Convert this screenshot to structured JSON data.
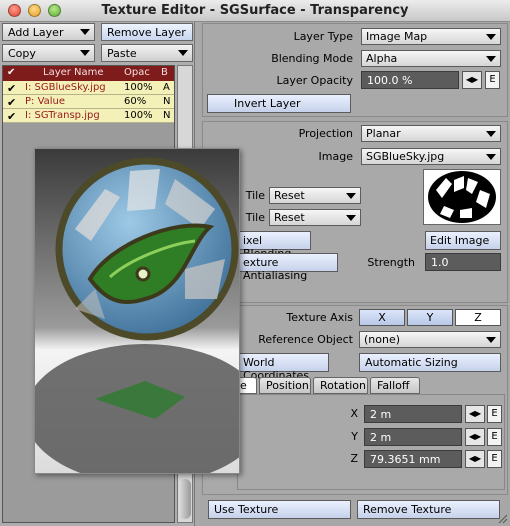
{
  "window": {
    "title": "Texture Editor - SGSurface - Transparency"
  },
  "left": {
    "add_layer": "Add Layer",
    "remove_layer": "Remove Layer",
    "copy": "Copy",
    "paste": "Paste",
    "columns": {
      "check": "✔",
      "name": "Layer Name",
      "opac": "Opac",
      "blend": "B"
    },
    "layers": [
      {
        "name": "I: SGBlueSky.jpg",
        "opac": "100%",
        "blend": "A",
        "checked": "✔"
      },
      {
        "name": "P: Value",
        "opac": "60%",
        "blend": "N",
        "checked": "✔"
      },
      {
        "name": "I: SGTransp.jpg",
        "opac": "100%",
        "blend": "N",
        "checked": "✔"
      }
    ]
  },
  "layer": {
    "type_label": "Layer Type",
    "type_value": "Image Map",
    "blend_label": "Blending Mode",
    "blend_value": "Alpha",
    "opacity_label": "Layer Opacity",
    "opacity_value": "100.0 %",
    "invert": "Invert Layer",
    "e": "E"
  },
  "image": {
    "projection_label": "Projection",
    "projection_value": "Planar",
    "image_label": "Image",
    "image_value": "SGBlueSky.jpg",
    "tile1_label": "Tile",
    "tile1_value": "Reset",
    "tile2_label": "Tile",
    "tile2_value": "Reset",
    "pixel_blending": "ixel Blending",
    "texture_aa": "exture Antialiasing",
    "edit_image": "Edit Image",
    "strength_label": "Strength",
    "strength_value": "1.0"
  },
  "axis": {
    "label": "Texture Axis",
    "options": [
      "X",
      "Y",
      "Z"
    ],
    "selected": "Z",
    "ref_label": "Reference Object",
    "ref_value": "(none)",
    "world_coords": "World Coordinates",
    "auto_sizing": "Automatic Sizing"
  },
  "tabs": [
    "e",
    "Position",
    "Rotation",
    "Falloff"
  ],
  "size": {
    "x_label": "X",
    "x_value": "2 m",
    "y_label": "Y",
    "y_value": "2 m",
    "z_label": "Z",
    "z_value": "79.3651 mm"
  },
  "footer": {
    "use": "Use Texture",
    "remove": "Remove Texture"
  },
  "colors": {
    "header": "#7e1b1b",
    "layer_row": "#f3f0b8",
    "field": "#5c5c5c"
  }
}
